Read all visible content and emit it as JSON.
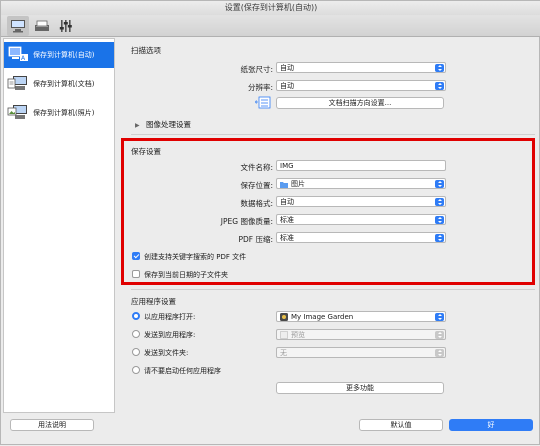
{
  "window": {
    "title": "设置(保存到计算机(自动))"
  },
  "toolbar": {
    "tabs": [
      {
        "icon": "scan-to-computer-icon"
      },
      {
        "icon": "scan-from-panel-icon"
      },
      {
        "icon": "general-settings-icon"
      }
    ]
  },
  "sidebar": {
    "items": [
      {
        "label": "保存到计算机(自动)",
        "selected": true
      },
      {
        "label": "保存到计算机(文档)",
        "selected": false
      },
      {
        "label": "保存到计算机(照片)",
        "selected": false
      }
    ]
  },
  "scan_options": {
    "heading": "扫描选项",
    "paper_size_label": "纸张尺寸:",
    "paper_size_value": "自动",
    "resolution_label": "分辨率:",
    "resolution_value": "自动",
    "orientation_button": "文档扫描方向设置...",
    "image_processing": "图像处理设置"
  },
  "save_settings": {
    "heading": "保存设置",
    "filename_label": "文件名称:",
    "filename_value": "IMG",
    "location_label": "保存位置:",
    "location_value": "图片",
    "format_label": "数据格式:",
    "format_value": "自动",
    "jpeg_label": "JPEG 图像质量:",
    "jpeg_value": "标准",
    "pdf_label": "PDF 压缩:",
    "pdf_value": "标准",
    "keyword_pdf_label": "创建支持关键字搜索的 PDF 文件",
    "keyword_pdf_checked": true,
    "subfolder_label": "保存到当前日期的子文件夹",
    "subfolder_checked": false
  },
  "app_settings": {
    "heading": "应用程序设置",
    "open_with_label": "以应用程序打开:",
    "open_with_value": "My Image Garden",
    "send_app_label": "发送到应用程序:",
    "send_app_value": "预览",
    "send_folder_label": "发送到文件夹:",
    "send_folder_value": "无",
    "no_app_label": "请不要启动任何应用程序",
    "more_button": "更多功能"
  },
  "footer": {
    "help": "用法说明",
    "defaults": "默认值",
    "ok": "好"
  },
  "colors": {
    "accent": "#2f7cf6",
    "highlight": "#e00000",
    "selected": "#1a73e8"
  }
}
